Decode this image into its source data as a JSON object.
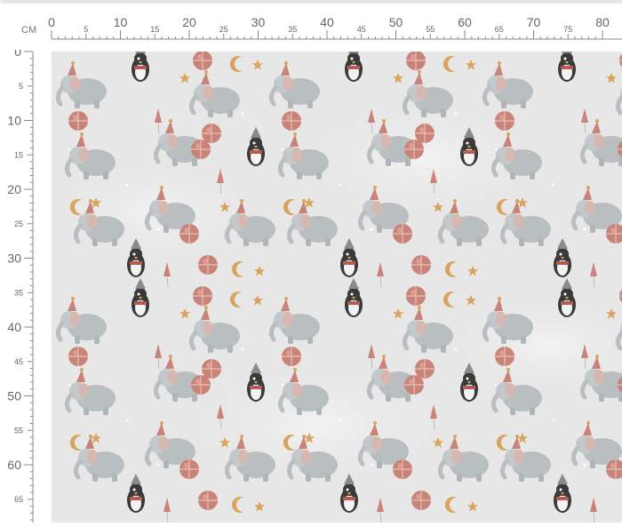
{
  "ruler": {
    "unit": "CM",
    "top_labels_major": [
      "0",
      "10",
      "20",
      "30",
      "40",
      "50",
      "60",
      "70",
      "80"
    ],
    "top_labels_minor": [
      "5",
      "15",
      "25",
      "35",
      "45",
      "55",
      "65",
      "75"
    ],
    "left_labels_major": [
      "0",
      "10",
      "20",
      "30",
      "40",
      "50",
      "60"
    ],
    "left_labels_minor": [
      "5",
      "15",
      "25",
      "35",
      "45",
      "55",
      "65"
    ]
  },
  "colors": {
    "ruler_text": "#666666",
    "fabric_bg": "#e7e7e7",
    "elephant": "#b9bfc1",
    "ball": "#c98378",
    "star": "#d8a45e",
    "penguin": "#3a3a3a"
  },
  "pattern_motifs": [
    "elephant-on-ball-icon",
    "penguin-icon",
    "balloon-icon",
    "moon-icon",
    "star-icon",
    "party-hat-icon"
  ]
}
